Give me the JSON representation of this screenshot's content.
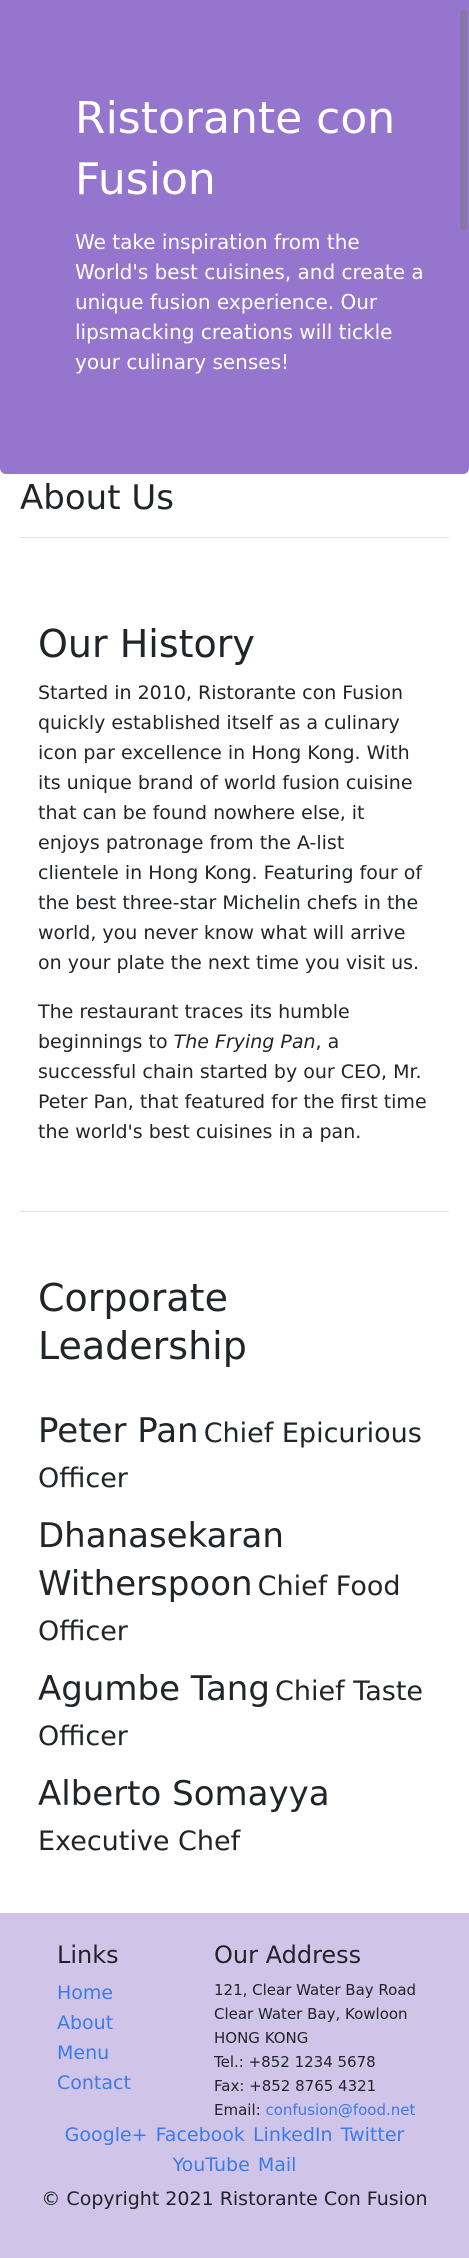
{
  "jumbotron": {
    "title": "Ristorante con Fusion",
    "tagline": "We take inspiration from the World's best cuisines, and create a unique fusion experience. Our lipsmacking creations will tickle your culinary senses!"
  },
  "page": {
    "heading": "About Us"
  },
  "history": {
    "title": "Our History",
    "paragraph1": "Started in 2010, Ristorante con Fusion quickly established itself as a culinary icon par excellence in Hong Kong. With its unique brand of world fusion cuisine that can be found nowhere else, it enjoys patronage from the A-list clientele in Hong Kong. Featuring four of the best three-star Michelin chefs in the world, you never know what will arrive on your plate the next time you visit us.",
    "paragraph2_before": "The restaurant traces its humble beginnings to ",
    "paragraph2_em": "The Frying Pan",
    "paragraph2_after": ", a successful chain started by our CEO, Mr. Peter Pan, that featured for the first time the world's best cuisines in a pan."
  },
  "leadership": {
    "title": "Corporate Leadership",
    "leaders": [
      {
        "name": "Peter Pan",
        "role": "Chief Epicurious Officer"
      },
      {
        "name": "Dhanasekaran Witherspoon",
        "role": "Chief Food Officer"
      },
      {
        "name": "Agumbe Tang",
        "role": "Chief Taste Officer"
      },
      {
        "name": "Alberto Somayya",
        "role": "Executive Chef"
      }
    ]
  },
  "footer": {
    "links_title": "Links",
    "links": [
      "Home",
      "About",
      "Menu",
      "Contact"
    ],
    "address_title": "Our Address",
    "address_lines": [
      "121, Clear Water Bay Road",
      "Clear Water Bay, Kowloon",
      "HONG KONG",
      "Tel.: +852 1234 5678",
      "Fax: +852 8765 4321"
    ],
    "email_label": "Email: ",
    "email": "confusion@food.net",
    "social": [
      "Google+",
      "Facebook",
      "LinkedIn",
      "Twitter",
      "YouTube",
      "Mail"
    ],
    "copyright": "© Copyright 2021 Ristorante Con Fusion"
  },
  "colors": {
    "jumbotron_bg": "#9575cd",
    "footer_bg": "#d1c4e9",
    "link": "#3a7bea"
  }
}
